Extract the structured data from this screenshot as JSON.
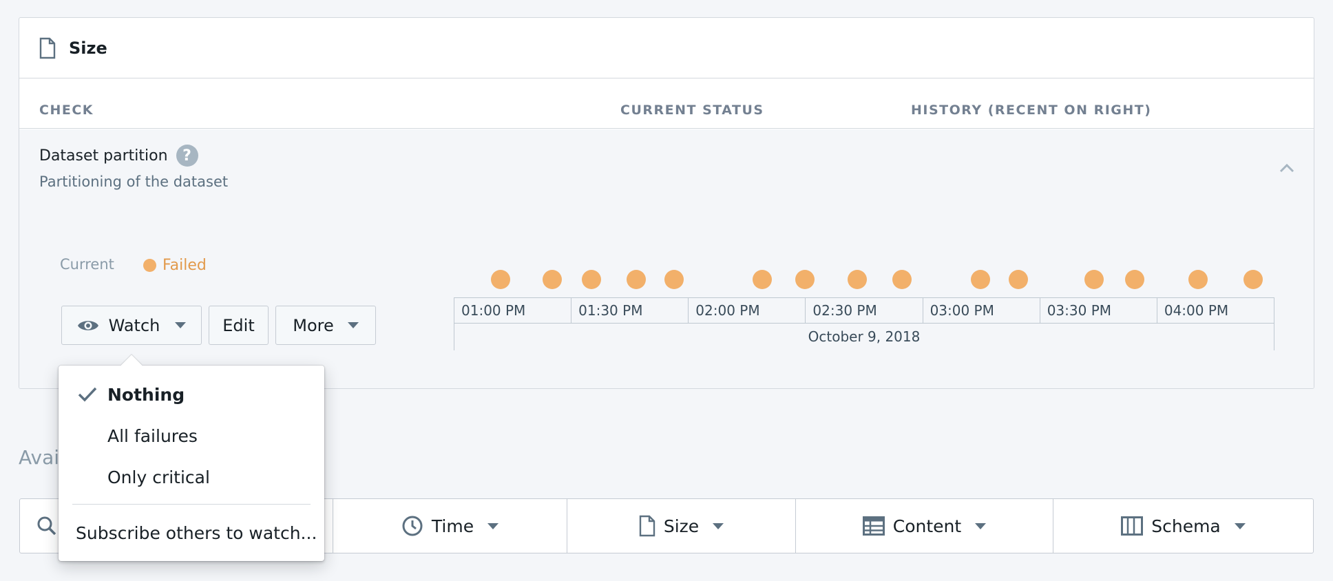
{
  "card": {
    "title": "Size",
    "columns": {
      "check": "CHECK",
      "current_status": "CURRENT STATUS",
      "history": "HISTORY (RECENT ON RIGHT)"
    }
  },
  "check": {
    "name": "Dataset partition",
    "help": "?",
    "description": "Partitioning of the dataset",
    "current_label": "Current",
    "status": "Failed",
    "status_color": "#f2b06a"
  },
  "actions": {
    "watch": "Watch",
    "edit": "Edit",
    "more": "More"
  },
  "history": {
    "dot_color": "#f2b06a",
    "ticks": [
      "01:00 PM",
      "01:30 PM",
      "02:00 PM",
      "02:30 PM",
      "03:00 PM",
      "03:30 PM",
      "04:00 PM"
    ],
    "date": "October 9, 2018"
  },
  "watch_menu": {
    "items": [
      "Nothing",
      "All failures",
      "Only critical"
    ],
    "selected": "Nothing",
    "subscribe": "Subscribe others to watch..."
  },
  "available": {
    "label": "Avai"
  },
  "filters": [
    {
      "label": "Time",
      "icon": "clock-icon"
    },
    {
      "label": "Size",
      "icon": "file-icon"
    },
    {
      "label": "Content",
      "icon": "table-icon"
    },
    {
      "label": "Schema",
      "icon": "columns-icon"
    }
  ]
}
